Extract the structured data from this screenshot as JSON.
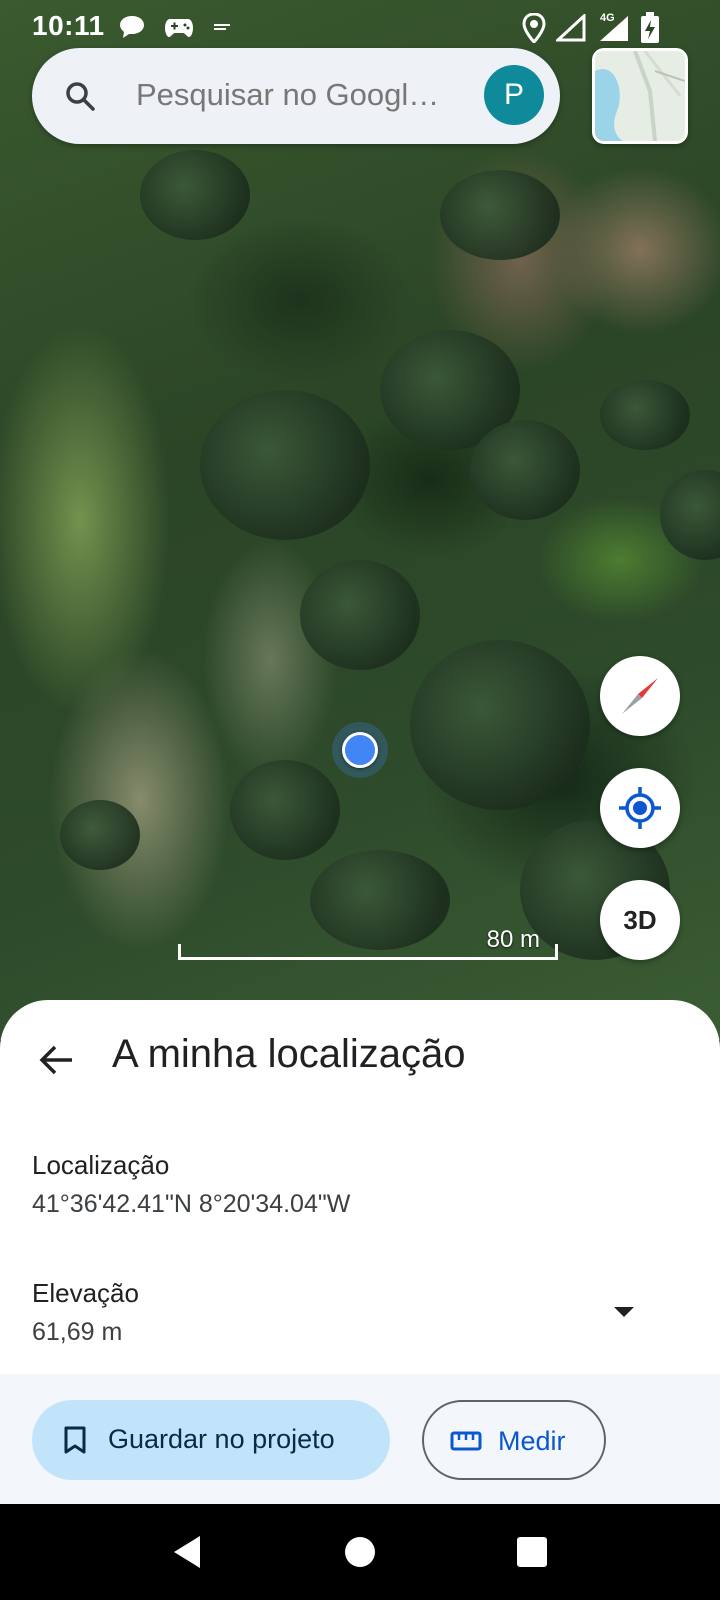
{
  "status_bar": {
    "time": "10:11",
    "left_icons": [
      "chat-bubble-icon",
      "gamepad-icon",
      "minus-icon"
    ],
    "right_icons": [
      "location-pin-icon",
      "signal-icon",
      "network-4g-icon",
      "battery-charging-icon"
    ],
    "network_label": "4G"
  },
  "search": {
    "placeholder": "Pesquisar no Googl…",
    "avatar_letter": "P",
    "avatar_color": "#0e8a9a"
  },
  "map": {
    "scale_label": "80 m",
    "controls": {
      "compass_icon": "compass-icon",
      "locate_icon": "my-location-icon",
      "view_3d_label": "3D"
    },
    "location_dot_color": "#4285f4"
  },
  "sheet": {
    "title": "A minha localização",
    "location_label": "Localização",
    "location_value": "41°36'42.41\"N 8°20'34.04\"W",
    "elevation_label": "Elevação",
    "elevation_value": "61,69 m"
  },
  "actions": {
    "save_label": "Guardar no projeto",
    "measure_label": "Medir",
    "save_bg": "#c2e4fb",
    "measure_color": "#0b57d0"
  },
  "nav": {
    "icons": [
      "back-triangle-icon",
      "home-circle-icon",
      "recents-square-icon"
    ]
  }
}
